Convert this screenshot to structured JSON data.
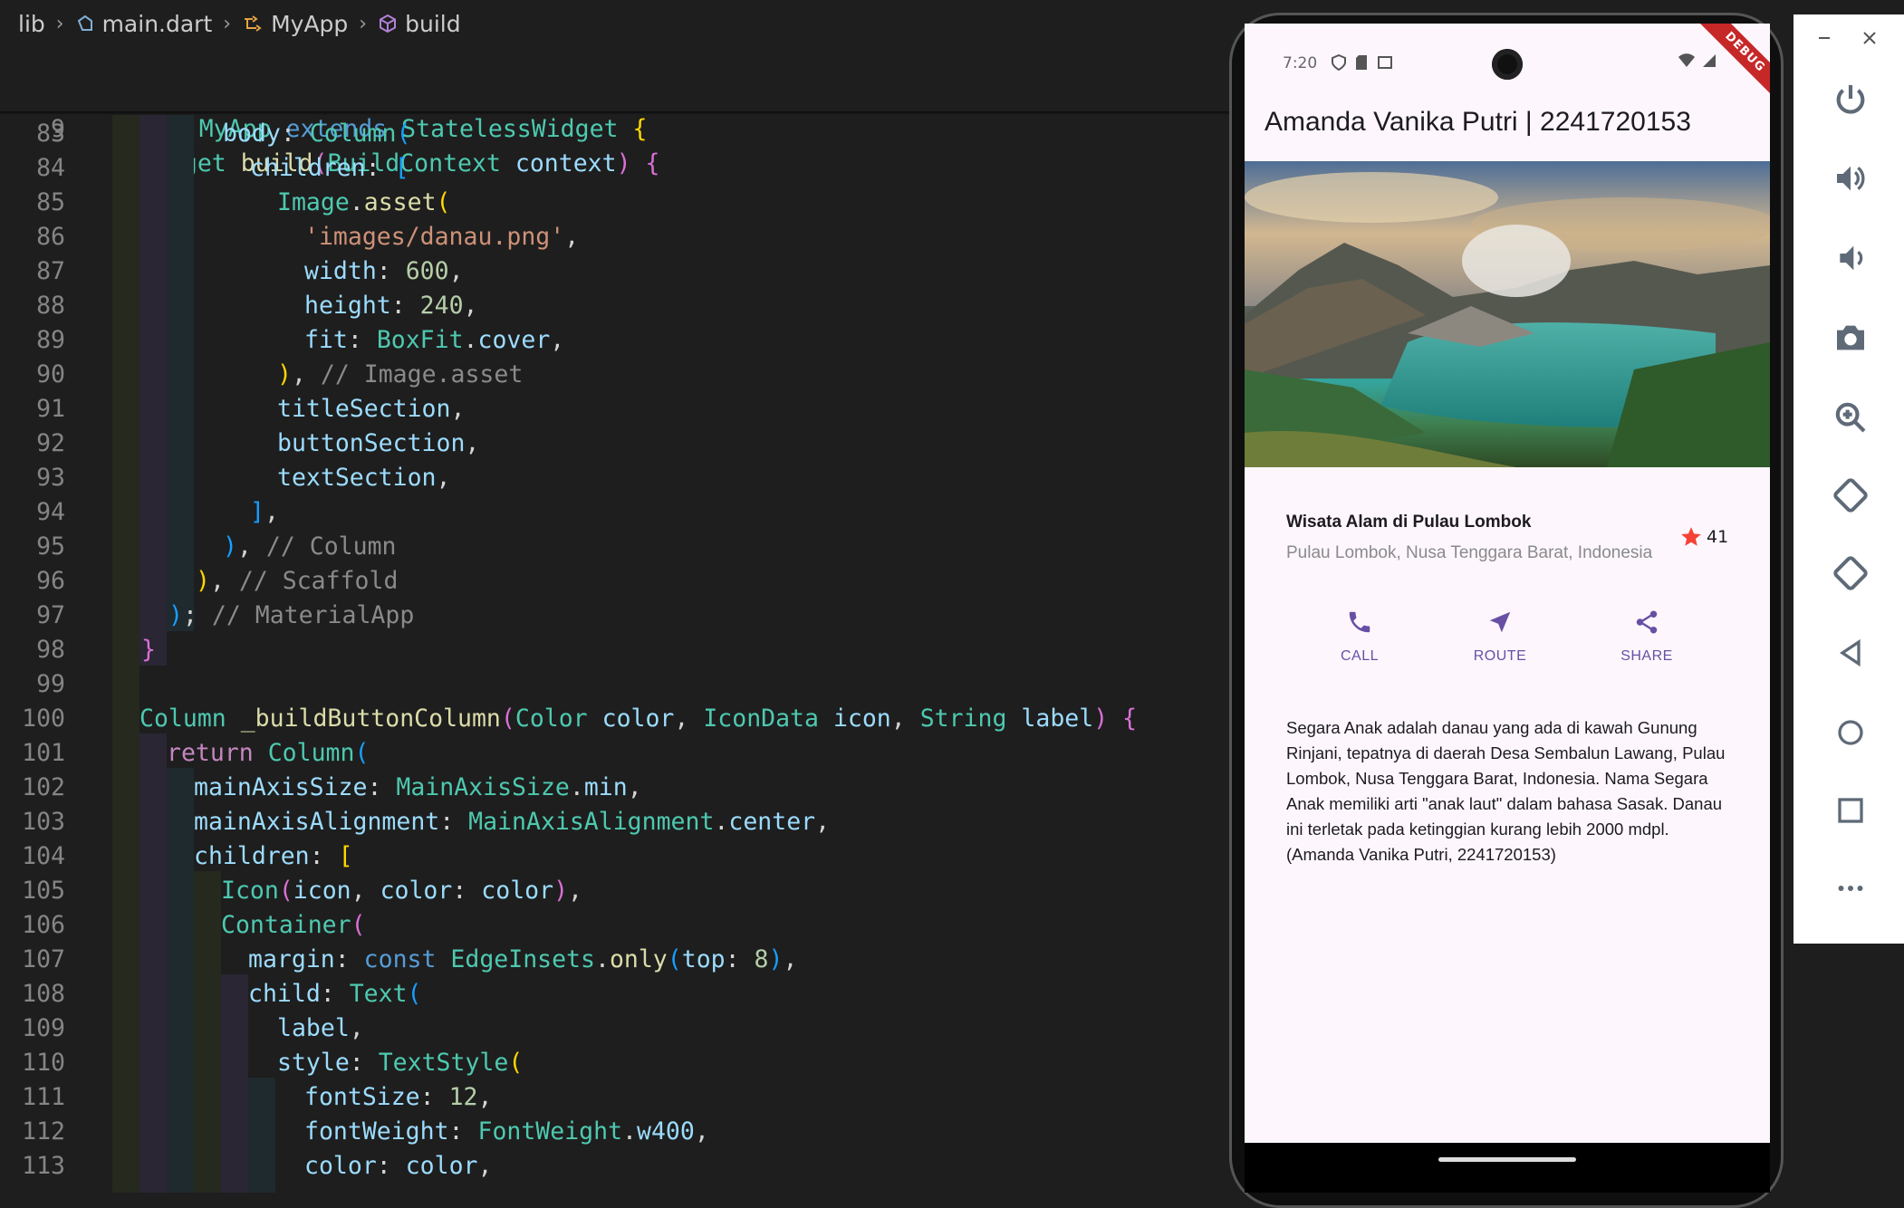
{
  "editor": {
    "breadcrumb": {
      "items": [
        "lib",
        "main.dart",
        "MyApp",
        "build"
      ]
    },
    "sticky": [
      {
        "ln": "5",
        "text": "class MyApp extends StatelessWidget {"
      },
      {
        "ln": "9",
        "text": "Widget build(BuildContext context) {"
      }
    ],
    "lines": [
      {
        "ln": "83",
        "text": "body: Column("
      },
      {
        "ln": "84",
        "text": "children: ["
      },
      {
        "ln": "85",
        "text": "Image.asset("
      },
      {
        "ln": "86",
        "text": "'images/danau.png',"
      },
      {
        "ln": "87",
        "text": "width: 600,"
      },
      {
        "ln": "88",
        "text": "height: 240,"
      },
      {
        "ln": "89",
        "text": "fit: BoxFit.cover,"
      },
      {
        "ln": "90",
        "text": "), // Image.asset"
      },
      {
        "ln": "91",
        "text": "titleSection,"
      },
      {
        "ln": "92",
        "text": "buttonSection,"
      },
      {
        "ln": "93",
        "text": "textSection,"
      },
      {
        "ln": "94",
        "text": "],"
      },
      {
        "ln": "95",
        "text": "), // Column"
      },
      {
        "ln": "96",
        "text": "), // Scaffold"
      },
      {
        "ln": "97",
        "text": "); // MaterialApp"
      },
      {
        "ln": "98",
        "text": "}"
      },
      {
        "ln": "99",
        "text": ""
      },
      {
        "ln": "100",
        "text": "Column _buildButtonColumn(Color color, IconData icon, String label) {"
      },
      {
        "ln": "101",
        "text": "return Column("
      },
      {
        "ln": "102",
        "text": "mainAxisSize: MainAxisSize.min,"
      },
      {
        "ln": "103",
        "text": "mainAxisAlignment: MainAxisAlignment.center,"
      },
      {
        "ln": "104",
        "text": "children: ["
      },
      {
        "ln": "105",
        "text": "Icon(icon, color: color),"
      },
      {
        "ln": "106",
        "text": "Container("
      },
      {
        "ln": "107",
        "text": "margin: const EdgeInsets.only(top: 8),"
      },
      {
        "ln": "108",
        "text": "child: Text("
      },
      {
        "ln": "109",
        "text": "label,"
      },
      {
        "ln": "110",
        "text": "style: TextStyle("
      },
      {
        "ln": "111",
        "text": "fontSize: 12,"
      },
      {
        "ln": "112",
        "text": "fontWeight: FontWeight.w400,"
      },
      {
        "ln": "113",
        "text": "color: color,"
      }
    ]
  },
  "phone": {
    "status_time": "7:20",
    "debug_banner": "DEBUG",
    "appbar_title": "Amanda Vanika Putri | 2241720153",
    "place_title": "Wisata Alam di Pulau Lombok",
    "place_subtitle": "Pulau Lombok, Nusa Tenggara Barat, Indonesia",
    "rating": "41",
    "buttons": [
      {
        "label": "CALL",
        "icon": "phone-icon"
      },
      {
        "label": "ROUTE",
        "icon": "navigation-icon"
      },
      {
        "label": "SHARE",
        "icon": "share-icon"
      }
    ],
    "description": "Segara Anak adalah danau yang ada di kawah Gunung Rinjani, tepatnya di daerah Desa Sembalun Lawang, Pulau Lombok, Nusa Tenggara Barat, Indonesia. Nama Segara Anak memiliki arti \"anak laut\" dalam bahasa Sasak. Danau ini terletak pada ketinggian kurang lebih 2000 mdpl.\n(Amanda Vanika Putri, 2241720153)",
    "accent_color": "#6750a4",
    "star_color": "#f44336"
  },
  "emulator_toolbar": {
    "icons": [
      "minimize-icon",
      "close-icon",
      "power-icon",
      "volume-up-icon",
      "volume-down-icon",
      "camera-icon",
      "zoom-icon",
      "rotate-left-icon",
      "rotate-right-icon",
      "back-icon",
      "home-icon",
      "overview-icon",
      "more-icon"
    ]
  }
}
